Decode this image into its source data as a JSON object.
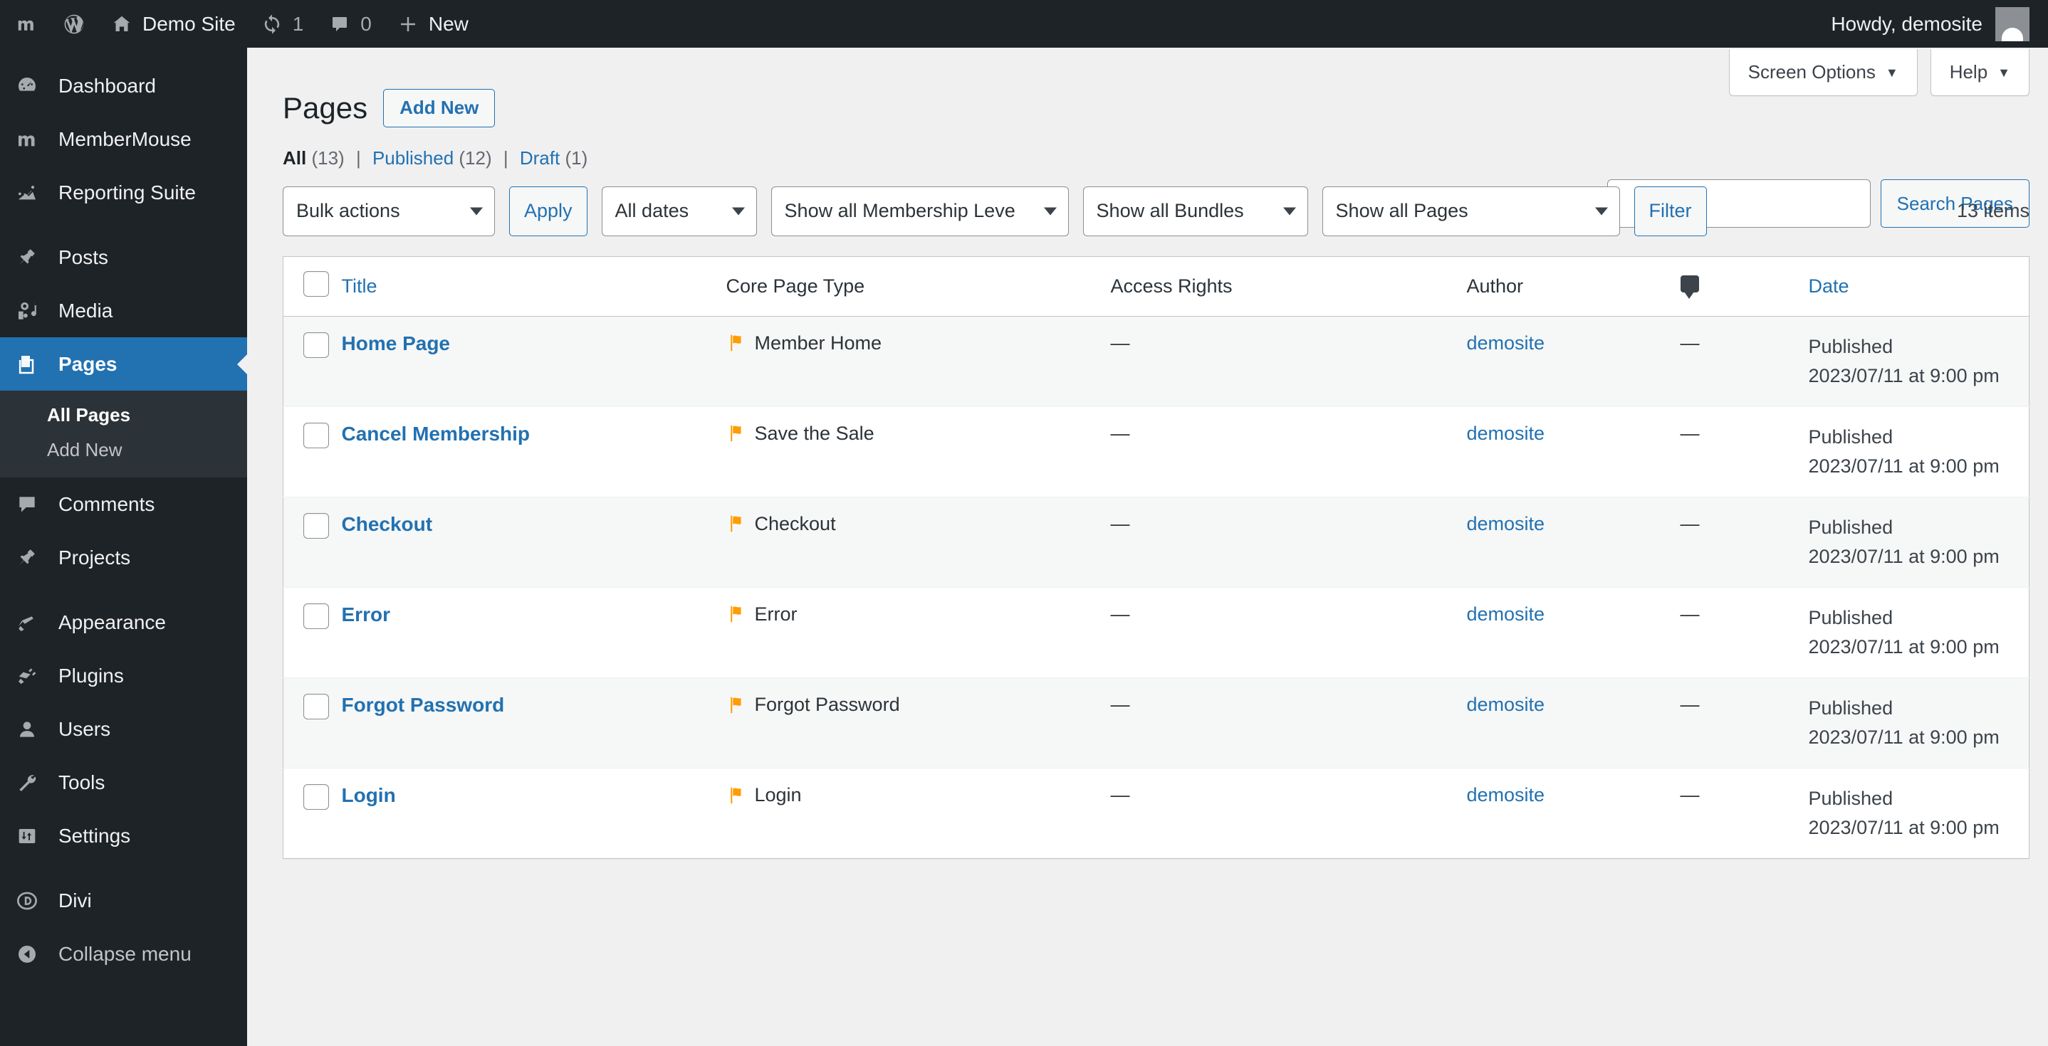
{
  "adminbar": {
    "logo_m": "m",
    "wp_icon": "wordpress-icon",
    "site_name": "Demo Site",
    "updates_count": "1",
    "comments_count": "0",
    "new_label": "New",
    "howdy": "Howdy, demosite"
  },
  "sidebar": {
    "items": [
      {
        "label": "Dashboard",
        "icon": "dashboard-icon",
        "current": false
      },
      {
        "label": "MemberMouse",
        "icon": "membermouse-icon",
        "current": false
      },
      {
        "label": "Reporting Suite",
        "icon": "chart-icon",
        "current": false
      },
      {
        "label": "Posts",
        "icon": "pin-icon",
        "current": false
      },
      {
        "label": "Media",
        "icon": "media-icon",
        "current": false
      },
      {
        "label": "Pages",
        "icon": "pages-icon",
        "current": true
      },
      {
        "label": "Comments",
        "icon": "comment-icon",
        "current": false
      },
      {
        "label": "Projects",
        "icon": "pin-icon",
        "current": false
      },
      {
        "label": "Appearance",
        "icon": "brush-icon",
        "current": false
      },
      {
        "label": "Plugins",
        "icon": "plug-icon",
        "current": false
      },
      {
        "label": "Users",
        "icon": "user-icon",
        "current": false
      },
      {
        "label": "Tools",
        "icon": "wrench-icon",
        "current": false
      },
      {
        "label": "Settings",
        "icon": "settings-icon",
        "current": false
      },
      {
        "label": "Divi",
        "icon": "divi-icon",
        "current": false
      },
      {
        "label": "Collapse menu",
        "icon": "collapse-icon",
        "current": false
      }
    ],
    "submenu": [
      {
        "label": "All Pages",
        "current": true
      },
      {
        "label": "Add New",
        "current": false
      }
    ]
  },
  "meta": {
    "screen_options": "Screen Options",
    "help": "Help"
  },
  "header": {
    "title": "Pages",
    "add_new": "Add New"
  },
  "views": {
    "all_label": "All",
    "all_count": "(13)",
    "published_label": "Published",
    "published_count": "(12)",
    "draft_label": "Draft",
    "draft_count": "(1)"
  },
  "search": {
    "value": "",
    "placeholder": "",
    "button": "Search Pages"
  },
  "tablenav": {
    "bulk_actions": "Bulk actions",
    "apply": "Apply",
    "all_dates": "All dates",
    "membership_levels": "Show all Membership Leve",
    "bundles": "Show all Bundles",
    "pages": "Show all Pages",
    "filter": "Filter",
    "items_count": "13 items"
  },
  "table": {
    "columns": {
      "title": "Title",
      "core_page_type": "Core Page Type",
      "access_rights": "Access Rights",
      "author": "Author",
      "comments": "comment-icon",
      "date": "Date"
    },
    "rows": [
      {
        "title": "Home Page",
        "core_page_type": "Member Home",
        "access_rights": "—",
        "author": "demosite",
        "comments": "—",
        "date_status": "Published",
        "date_value": "2023/07/11 at 9:00 pm"
      },
      {
        "title": "Cancel Membership",
        "core_page_type": "Save the Sale",
        "access_rights": "—",
        "author": "demosite",
        "comments": "—",
        "date_status": "Published",
        "date_value": "2023/07/11 at 9:00 pm"
      },
      {
        "title": "Checkout",
        "core_page_type": "Checkout",
        "access_rights": "—",
        "author": "demosite",
        "comments": "—",
        "date_status": "Published",
        "date_value": "2023/07/11 at 9:00 pm"
      },
      {
        "title": "Error",
        "core_page_type": "Error",
        "access_rights": "—",
        "author": "demosite",
        "comments": "—",
        "date_status": "Published",
        "date_value": "2023/07/11 at 9:00 pm"
      },
      {
        "title": "Forgot Password",
        "core_page_type": "Forgot Password",
        "access_rights": "—",
        "author": "demosite",
        "comments": "—",
        "date_status": "Published",
        "date_value": "2023/07/11 at 9:00 pm"
      },
      {
        "title": "Login",
        "core_page_type": "Login",
        "access_rights": "—",
        "author": "demosite",
        "comments": "—",
        "date_status": "Published",
        "date_value": "2023/07/11 at 9:00 pm"
      }
    ]
  },
  "colors": {
    "adminbar_bg": "#1d2327",
    "sidebar_bg": "#1d2327",
    "submenu_bg": "#2c3338",
    "current_menu": "#2271b1",
    "link_blue": "#2271b1",
    "page_bg": "#f0f0f1",
    "flag_orange": "#ff9c00"
  }
}
